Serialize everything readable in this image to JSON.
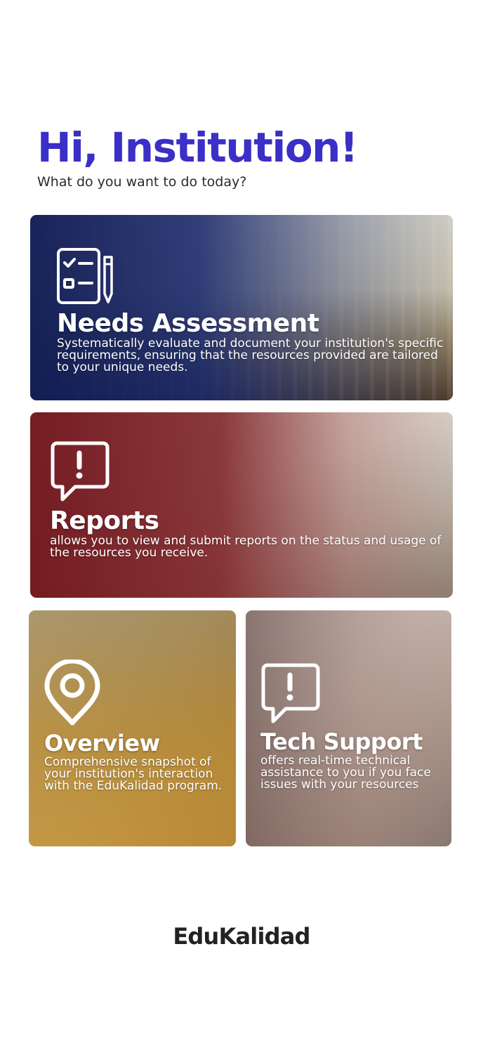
{
  "greeting": {
    "title": "Hi, Institution!",
    "subtitle": "What do you want to do today?"
  },
  "cards": [
    {
      "title": "Needs Assessment",
      "description": "Systematically evaluate and document your institution's specific requirements, ensuring that the resources provided are tailored to your unique needs.",
      "icon": "checklist-pencil-icon"
    },
    {
      "title": "Reports",
      "description": "allows you to view and submit reports on the status and usage of the resources you receive.",
      "icon": "alert-chat-icon"
    },
    {
      "title": "Overview",
      "description": "Comprehensive snapshot of your institution's interaction with the EduKalidad program.",
      "icon": "location-pin-icon"
    },
    {
      "title": "Tech Support",
      "description": "offers real-time technical assistance to you if you face issues with your resources",
      "icon": "alert-chat-icon"
    }
  ],
  "footer": {
    "brand": "EduKalidad"
  },
  "colors": {
    "accent": "#3a2fc6",
    "needs_overlay": "#1c2b6e",
    "reports_overlay": "#7e2226",
    "overview_overlay": "#b98a2e",
    "tech_overlay": "#8a6f66"
  }
}
